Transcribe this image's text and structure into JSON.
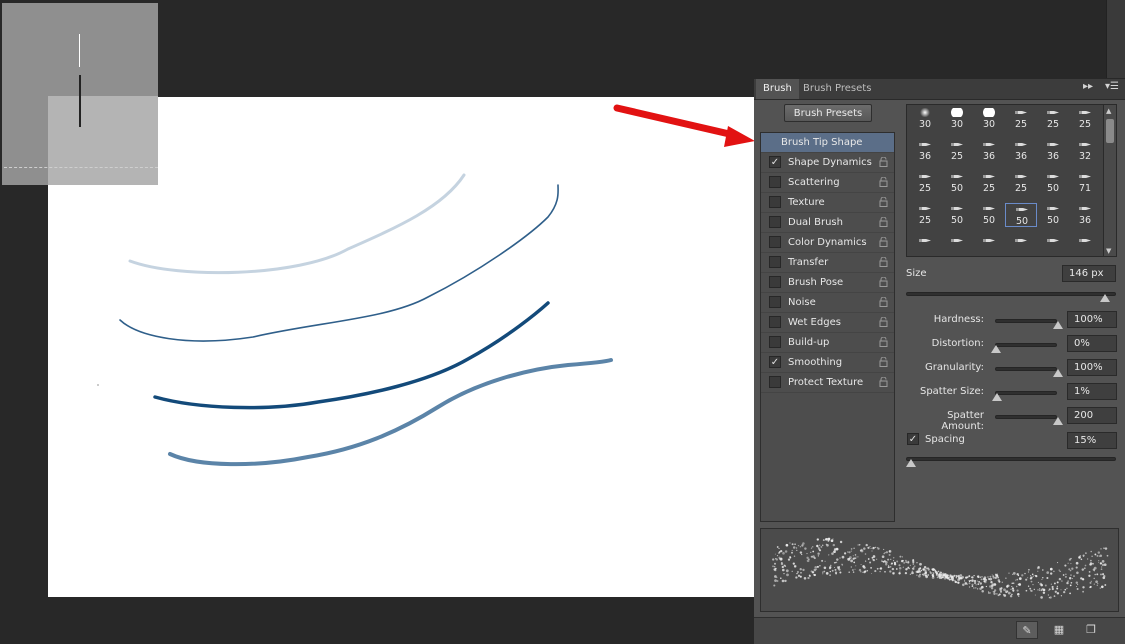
{
  "tabs": [
    {
      "label": "Brush",
      "active": true
    },
    {
      "label": "Brush Presets",
      "active": false
    }
  ],
  "panel_menu": {
    "collapse_icon": "double-chevron-right-icon",
    "menu_icon": "panel-menu-icon",
    "collapse_glyph": "▸▸",
    "menu_glyph": "▾☰"
  },
  "brush_presets_button": "Brush Presets",
  "options": [
    {
      "label": "Brush Tip Shape",
      "active": true,
      "checkbox": false,
      "checked": false
    },
    {
      "label": "Shape Dynamics",
      "checkbox": true,
      "checked": true
    },
    {
      "label": "Scattering",
      "checkbox": true,
      "checked": false
    },
    {
      "label": "Texture",
      "checkbox": true,
      "checked": false
    },
    {
      "label": "Dual Brush",
      "checkbox": true,
      "checked": false
    },
    {
      "label": "Color Dynamics",
      "checkbox": true,
      "checked": false
    },
    {
      "label": "Transfer",
      "checkbox": true,
      "checked": false
    },
    {
      "label": "Brush Pose",
      "checkbox": true,
      "checked": false
    },
    {
      "label": "Noise",
      "checkbox": true,
      "checked": false
    },
    {
      "label": "Wet Edges",
      "checkbox": true,
      "checked": false
    },
    {
      "label": "Build-up",
      "checkbox": true,
      "checked": false
    },
    {
      "label": "Smoothing",
      "checkbox": true,
      "checked": true
    },
    {
      "label": "Protect Texture",
      "checkbox": true,
      "checked": false
    }
  ],
  "check_glyph": "✓",
  "tip_sizes": [
    [
      "30",
      "30",
      "30",
      "25",
      "25",
      "25"
    ],
    [
      "36",
      "25",
      "36",
      "36",
      "36",
      "32"
    ],
    [
      "25",
      "50",
      "25",
      "25",
      "50",
      "71"
    ],
    [
      "25",
      "50",
      "50",
      "50",
      "50",
      "36"
    ],
    [
      "",
      "",
      "",
      "",
      "",
      ""
    ]
  ],
  "selected_tip": {
    "row": 3,
    "col": 3
  },
  "size": {
    "label": "Size",
    "value": "146 px",
    "fraction": 0.97
  },
  "params": [
    {
      "label": "Hardness:",
      "value": "100%",
      "fraction": 1.0
    },
    {
      "label": "Distortion:",
      "value": "0%",
      "fraction": 0.0
    },
    {
      "label": "Granularity:",
      "value": "100%",
      "fraction": 1.0
    },
    {
      "label": "Spatter Size:",
      "value": "1%",
      "fraction": 0.01
    },
    {
      "label": "Spatter Amount:",
      "value": "200",
      "fraction": 1.0
    }
  ],
  "spacing": {
    "label": "Spacing",
    "checked": true,
    "value": "15%",
    "fraction": 0.0
  },
  "bottom_buttons": [
    {
      "name": "toggle-live-tip-button",
      "icon": "brush-pose-icon",
      "glyph": "✎",
      "on": true
    },
    {
      "name": "brush-grid-button",
      "icon": "grid-icon",
      "glyph": "▦",
      "on": false
    },
    {
      "name": "create-new-brush-button",
      "icon": "new-page-icon",
      "glyph": "❐",
      "on": false
    }
  ],
  "colors": {
    "stroke_light": "#c5d3e0",
    "stroke_mid": "#2f5f8a",
    "stroke_dark": "#134a7a",
    "stroke_grainy": "#5b84a8",
    "arrow": "#e21212",
    "accent": "#5b6e88"
  }
}
